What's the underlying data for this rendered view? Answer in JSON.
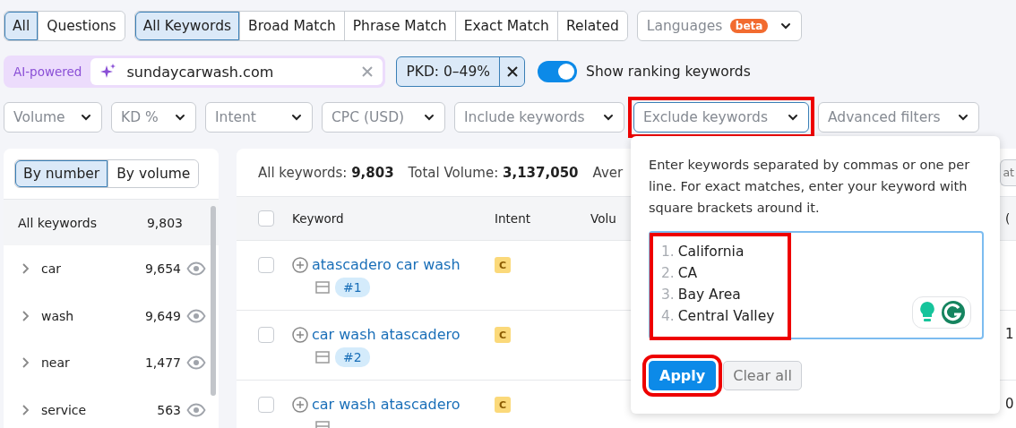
{
  "scope_tabs": [
    {
      "label": "All",
      "selected": true
    },
    {
      "label": "Questions",
      "selected": false
    }
  ],
  "match_tabs": [
    {
      "label": "All Keywords",
      "selected": true
    },
    {
      "label": "Broad Match",
      "selected": false
    },
    {
      "label": "Phrase Match",
      "selected": false
    },
    {
      "label": "Exact Match",
      "selected": false
    },
    {
      "label": "Related",
      "selected": false
    }
  ],
  "languages": {
    "label": "Languages",
    "badge": "beta"
  },
  "ai_search": {
    "label": "AI-powered",
    "value": "sundaycarwash.com"
  },
  "pkd_chip": {
    "label": "PKD: 0–49%"
  },
  "ranking_toggle": {
    "label": "Show ranking keywords",
    "on": true
  },
  "filters": [
    {
      "label": "Volume",
      "open": false,
      "highlighted": false
    },
    {
      "label": "KD %",
      "open": false,
      "highlighted": false
    },
    {
      "label": "Intent",
      "open": false,
      "highlighted": false
    },
    {
      "label": "CPC (USD)",
      "open": false,
      "highlighted": false
    },
    {
      "label": "Include keywords",
      "open": false,
      "highlighted": false
    },
    {
      "label": "Exclude keywords",
      "open": true,
      "highlighted": true
    },
    {
      "label": "Advanced filters",
      "open": false,
      "highlighted": false
    }
  ],
  "groups_panel": {
    "modes": [
      {
        "label": "By number",
        "selected": true
      },
      {
        "label": "By volume",
        "selected": false
      }
    ],
    "all": {
      "label": "All keywords",
      "count": "9,803"
    },
    "items": [
      {
        "label": "car",
        "count": "9,654"
      },
      {
        "label": "wash",
        "count": "9,649"
      },
      {
        "label": "near",
        "count": "1,477"
      },
      {
        "label": "service",
        "count": "563"
      }
    ]
  },
  "summary": [
    {
      "label": "All keywords:",
      "value": "9,803"
    },
    {
      "label": "Total Volume:",
      "value": "3,137,050"
    },
    {
      "label": "Aver"
    }
  ],
  "summary_button_partial": "at",
  "table": {
    "select_all_checked": false,
    "columns": [
      "Keyword",
      "Intent",
      "Volu",
      "("
    ],
    "rows": [
      {
        "checked": false,
        "keyword": "atascadero car wash",
        "rank": "#1",
        "intent": "C"
      },
      {
        "checked": false,
        "keyword": "car wash atascadero",
        "rank": "#2",
        "intent": "C",
        "column_4": "1"
      },
      {
        "checked": false,
        "keyword": "car wash atascadero",
        "intent": "C",
        "column_4": "0"
      }
    ]
  },
  "exclude_popup": {
    "help": "Enter keywords separated by commas or one per line. For exact matches, enter your keyword with square brackets around it.",
    "lines": [
      {
        "number": "1.",
        "text": "California"
      },
      {
        "number": "2.",
        "text": "CA"
      },
      {
        "number": "3.",
        "text": "Bay Area"
      },
      {
        "number": "4.",
        "text": "Central Valley"
      }
    ],
    "lines_highlighted": true,
    "apply": {
      "label": "Apply",
      "highlighted": true
    },
    "clear": {
      "label": "Clear all"
    }
  }
}
